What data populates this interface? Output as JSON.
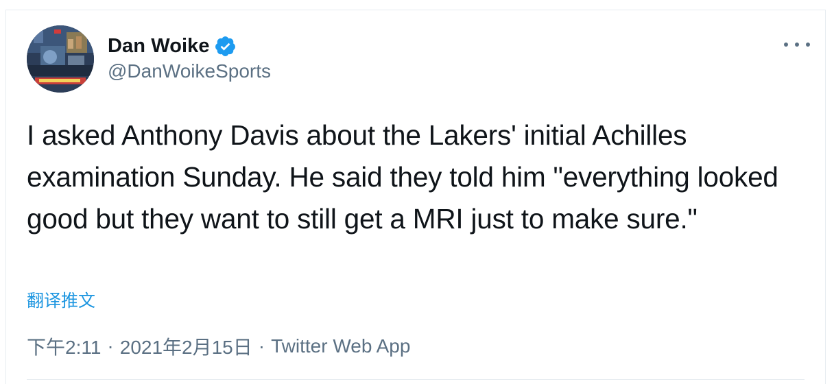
{
  "tweet": {
    "author": {
      "name": "Dan Woike",
      "handle": "@DanWoikeSports",
      "verified": true,
      "avatar_icon": "avatar-photo"
    },
    "text": "I asked Anthony Davis about the Lakers' initial Achilles examination Sunday. He said they told him \"everything looked good but they want to still get a MRI just to make sure.\"",
    "translate_label": "翻译推文",
    "time": "下午2:11",
    "date": "2021年2月15日",
    "separator": "·",
    "source": "Twitter Web App",
    "more_icon": "more-options-icon"
  },
  "colors": {
    "text_primary": "#0f1419",
    "text_secondary": "#5b7083",
    "link": "#1b95e0",
    "verified_badge": "#1d9bf0",
    "border": "#e6ecf0"
  }
}
